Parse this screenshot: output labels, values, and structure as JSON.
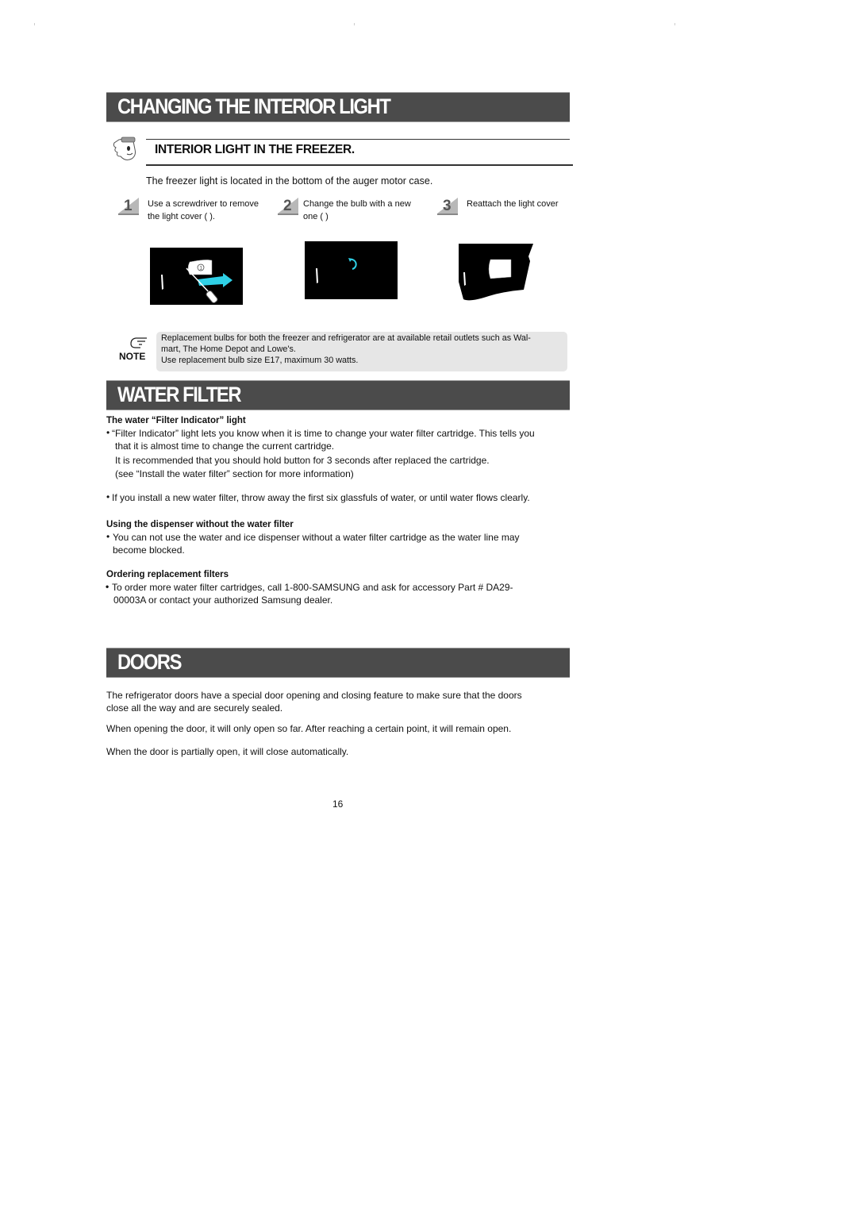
{
  "sections": {
    "interior_light": {
      "title": "CHANGING THE INTERIOR LIGHT",
      "subheading": "INTERIOR LIGHT IN THE FREEZER.",
      "intro": "The freezer light is located in the bottom of the auger motor case.",
      "steps": [
        {
          "number": "1",
          "line1": "Use a screwdriver to remove",
          "line2": "the light cover (    )."
        },
        {
          "number": "2",
          "line1": "Change the bulb with a new",
          "line2": "one (    )"
        },
        {
          "number": "3",
          "line1": "Reattach the light cover",
          "line2": ""
        }
      ],
      "figure_callout": "①",
      "note": {
        "label": "NOTE",
        "line1": "Replacement bulbs for both the freezer and refrigerator are at available retail outlets such as Wal-",
        "line2": "mart, The Home Depot and Lowe's.",
        "line3": "Use replacement bulb size E17, maximum 30 watts."
      }
    },
    "water_filter": {
      "title": "WATER FILTER",
      "indicator_heading": "The water “Filter Indicator” light",
      "indicator_line1": "“Filter Indicator” light lets you know when it is time to change your water filter cartridge. This tells you",
      "indicator_line2": "that it is almost time to change the current cartridge.",
      "indicator_line3": "It is recommended that you should hold button for 3 seconds after replaced the cartridge.",
      "indicator_line4": "(see “Install the water filter” section for more information)",
      "install_bullet": "If you install a new water filter, throw away the first six glassfuls of water, or until water flows clearly.",
      "dispenser_heading": "Using the dispenser without the water filter",
      "dispenser_line1": "You can not use the water and ice dispenser without a water filter cartridge as the water line may",
      "dispenser_line2": "become blocked.",
      "ordering_heading": "Ordering replacement filters",
      "ordering_line1": "To order more water filter cartridges, call 1-800-SAMSUNG and ask for accessory Part # DA29-",
      "ordering_line2": "00003A or contact your authorized Samsung dealer."
    },
    "doors": {
      "title": "DOORS",
      "para1_line1": "The refrigerator doors have a special door opening and closing feature to make sure that the doors",
      "para1_line2": "close all the way and are securely sealed.",
      "para2": "When opening the door, it will only open so far. After reaching a certain point, it will remain open.",
      "para3": "When the door is partially open, it will close automatically."
    }
  },
  "page_number": "16",
  "colors": {
    "section_bar": "#4b4b4b",
    "note_background": "#e6e6e6",
    "accent_cyan": "#2fd0e6"
  }
}
